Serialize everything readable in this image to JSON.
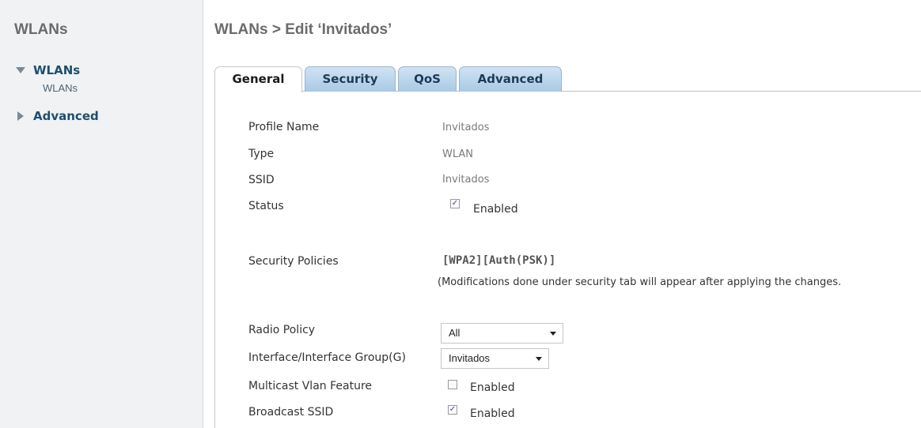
{
  "sidebar": {
    "title": "WLANs",
    "sections": [
      {
        "label": "WLANs",
        "expanded": true,
        "subitems": [
          "WLANs"
        ]
      },
      {
        "label": "Advanced",
        "expanded": false
      }
    ]
  },
  "header": {
    "title": "WLANs > Edit  ‘Invitados’"
  },
  "tabs": [
    {
      "label": "General",
      "active": true
    },
    {
      "label": "Security",
      "active": false
    },
    {
      "label": "QoS",
      "active": false
    },
    {
      "label": "Advanced",
      "active": false
    }
  ],
  "form": {
    "profile_name": {
      "label": "Profile Name",
      "value": "Invitados"
    },
    "type": {
      "label": "Type",
      "value": "WLAN"
    },
    "ssid": {
      "label": "SSID",
      "value": "Invitados"
    },
    "status": {
      "label": "Status",
      "checked": true,
      "option": "Enabled"
    },
    "security_policies": {
      "label": "Security Policies",
      "value": "[WPA2][Auth(PSK)]",
      "note": "(Modifications done under security tab will appear after applying the changes."
    },
    "radio_policy": {
      "label": "Radio Policy",
      "selected": "All"
    },
    "interface_group": {
      "label": "Interface/Interface Group(G)",
      "selected": "Invitados"
    },
    "multicast_vlan": {
      "label": "Multicast Vlan Feature",
      "checked": false,
      "option": "Enabled"
    },
    "broadcast_ssid": {
      "label": "Broadcast SSID",
      "checked": true,
      "option": "Enabled"
    }
  },
  "colors": {
    "tab_inactive": "#a9c9e4",
    "nav_text": "#1d4f6e",
    "sidebar_bg": "#f1f2f3"
  },
  "icons": {
    "expanded": "triangle-down-icon",
    "collapsed": "triangle-right-icon",
    "checkmark": "checkmark-icon",
    "dropdown": "caret-down-icon"
  }
}
